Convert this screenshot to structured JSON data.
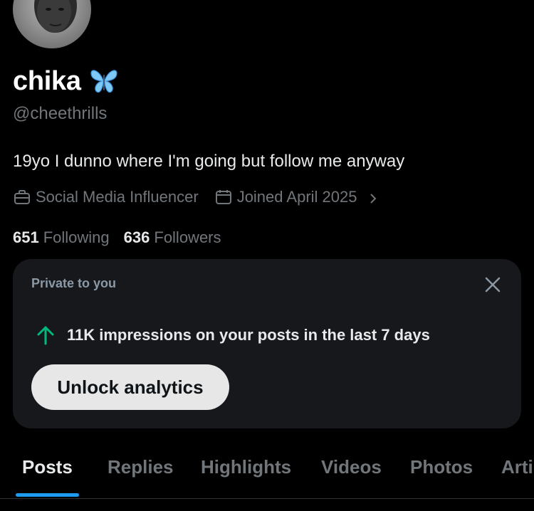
{
  "profile": {
    "display_name": "chika",
    "handle": "@cheethrills",
    "bio": "19yo I dunno where I'm going but follow me anyway",
    "category": "Social Media Influencer",
    "joined": "Joined April 2025",
    "verified_badge": "blue-butterfly-emoji"
  },
  "stats": {
    "following_count": "651",
    "following_label": "Following",
    "followers_count": "636",
    "followers_label": "Followers"
  },
  "analytics_card": {
    "label": "Private to you",
    "impressions_text": "11K impressions on your posts in the last 7 days",
    "unlock_button": "Unlock analytics",
    "trend_color": "#00ba7c"
  },
  "tabs": [
    {
      "label": "Posts",
      "active": true
    },
    {
      "label": "Replies",
      "active": false
    },
    {
      "label": "Highlights",
      "active": false
    },
    {
      "label": "Videos",
      "active": false
    },
    {
      "label": "Photos",
      "active": false
    },
    {
      "label": "Arti",
      "active": false
    }
  ],
  "colors": {
    "accent": "#1d9bf0",
    "background": "#000000",
    "card_background": "#16181c",
    "secondary_text": "#71767b"
  }
}
